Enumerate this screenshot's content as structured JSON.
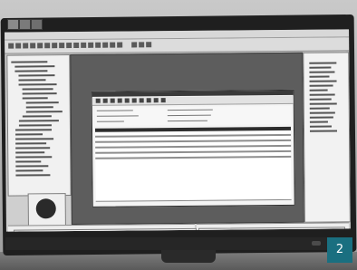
{
  "figure": {
    "number_label": "2",
    "badge_color": "#1a6f80"
  },
  "scene": {
    "objects": [
      "monitor",
      "monitor-stand",
      "desk"
    ],
    "screen_windows": [
      "left-tree-panel",
      "center-workarea",
      "dialog-window",
      "right-panel",
      "log-panel",
      "status-panel"
    ],
    "icons": [
      "dialog-toolbar-icons",
      "app-toolbar-icons"
    ]
  },
  "colors": {
    "wall": "#c0c0c0",
    "bezel": "#1f1f1f",
    "screen_bg": "#cfcfcf",
    "workarea": "#5d5d5d",
    "dialog_bg": "#f4f4f4"
  }
}
